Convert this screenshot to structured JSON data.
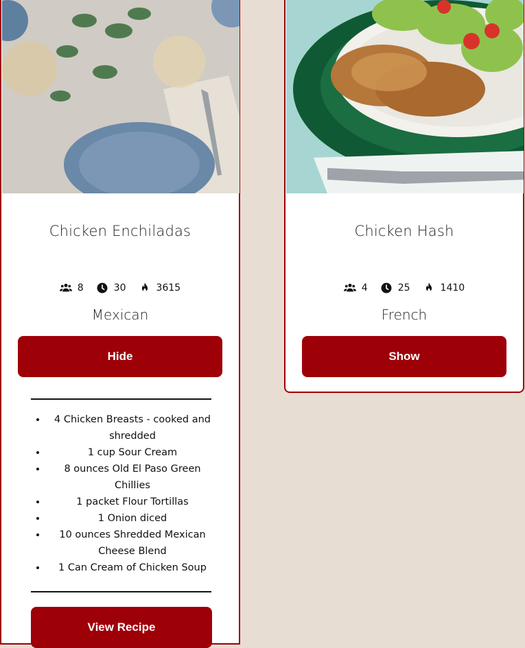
{
  "recipes": [
    {
      "title": "Chicken Enchiladas",
      "servings": "8",
      "time": "30",
      "calories": "3615",
      "cuisine": "Mexican",
      "toggle_label": "Hide",
      "ingredients": [
        "4 Chicken Breasts - cooked and shredded",
        "1 cup Sour Cream",
        "8 ounces Old El Paso Green Chillies",
        "1 packet Flour Tortillas",
        "1 Onion diced",
        "10 ounces Shredded Mexican Cheese Blend",
        "1 Can Cream of Chicken Soup"
      ],
      "view_label": "View Recipe"
    },
    {
      "title": "Chicken Hash",
      "servings": "4",
      "time": "25",
      "calories": "1410",
      "cuisine": "French",
      "toggle_label": "Show"
    }
  ],
  "colors": {
    "accent": "#9e0008",
    "background": "#e8ddd3"
  },
  "icons": [
    "people-icon",
    "clock-icon",
    "flame-icon"
  ]
}
